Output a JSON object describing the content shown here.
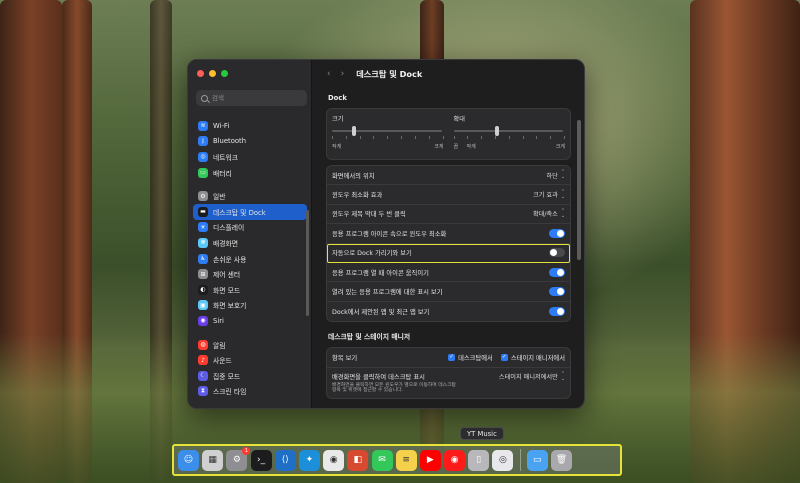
{
  "window": {
    "title": "데스크탑 및 Dock",
    "back_icon": "chevron-left-icon",
    "forward_icon": "chevron-right-icon"
  },
  "sidebar": {
    "search_placeholder": "검색",
    "items": [
      {
        "label": "Wi-Fi",
        "icon": "wifi-icon",
        "color": "#2d7cf6",
        "glyph": "≋"
      },
      {
        "label": "Bluetooth",
        "icon": "bluetooth-icon",
        "color": "#2d7cf6",
        "glyph": "ᛒ"
      },
      {
        "label": "네트워크",
        "icon": "network-icon",
        "color": "#2d7cf6",
        "glyph": "◎"
      },
      {
        "label": "배터리",
        "icon": "battery-icon",
        "color": "#34c759",
        "glyph": "▭"
      },
      {
        "label": "일반",
        "icon": "gear-icon",
        "color": "#8e8e93",
        "glyph": "⚙"
      },
      {
        "label": "데스크탑 및 Dock",
        "icon": "dock-icon",
        "color": "#1c1c1e",
        "glyph": "▬"
      },
      {
        "label": "디스플레이",
        "icon": "display-icon",
        "color": "#2d7cf6",
        "glyph": "☀"
      },
      {
        "label": "배경화면",
        "icon": "wallpaper-icon",
        "color": "#5ac8fa",
        "glyph": "❋"
      },
      {
        "label": "손쉬운 사용",
        "icon": "accessibility-icon",
        "color": "#2d7cf6",
        "glyph": "♿"
      },
      {
        "label": "제어 센터",
        "icon": "control-center-icon",
        "color": "#8e8e93",
        "glyph": "⊞"
      },
      {
        "label": "화면 모드",
        "icon": "appearance-icon",
        "color": "#1c1c1e",
        "glyph": "◐"
      },
      {
        "label": "화면 보호기",
        "icon": "screensaver-icon",
        "color": "#5ac8fa",
        "glyph": "▣"
      },
      {
        "label": "Siri",
        "icon": "siri-icon",
        "color": "#6a3de8",
        "glyph": "◉"
      },
      {
        "label": "알림",
        "icon": "notifications-icon",
        "color": "#ff3b30",
        "glyph": "◍"
      },
      {
        "label": "사운드",
        "icon": "sound-icon",
        "color": "#ff3b30",
        "glyph": "♪"
      },
      {
        "label": "집중 모드",
        "icon": "focus-icon",
        "color": "#5e5ce6",
        "glyph": "☾"
      },
      {
        "label": "스크린 타임",
        "icon": "screentime-icon",
        "color": "#5e5ce6",
        "glyph": "⧗"
      }
    ],
    "active_index": 5
  },
  "dock_section": {
    "header": "Dock",
    "size": {
      "label": "크기",
      "min": "작게",
      "max": "크게",
      "value": 0.18
    },
    "magnify": {
      "label": "확대",
      "min": "끔",
      "small": "작게",
      "max": "크게",
      "value": 0.38
    }
  },
  "rows": [
    {
      "label": "화면에서의 위치",
      "type": "popup",
      "value": "하단"
    },
    {
      "label": "윈도우 최소화 효과",
      "type": "popup",
      "value": "크기 효과"
    },
    {
      "label": "윈도우 제목 막대 두 번 클릭",
      "type": "popup",
      "value": "확대/축소"
    },
    {
      "label": "응용 프로그램 아이콘 속으로 윈도우 최소화",
      "type": "toggle",
      "value": true
    },
    {
      "label": "자동으로 Dock 가리기와 보기",
      "type": "toggle",
      "value": false
    },
    {
      "label": "응용 프로그램 열 때 아이콘 움직이기",
      "type": "toggle",
      "value": true
    },
    {
      "label": "열려 있는 응용 프로그램에 대한 표시 보기",
      "type": "toggle",
      "value": true
    },
    {
      "label": "Dock에서 제안된 앱 및 최근 앱 보기",
      "type": "toggle",
      "value": true
    }
  ],
  "stage_section": {
    "header": "데스크탑 및 스테이지 매니저",
    "show_items": {
      "label": "항목 보기",
      "opt1": "데스크탑에서",
      "opt2": "스테이지 매니저에서"
    },
    "click_wallpaper": {
      "label": "배경화면을 클릭하여 데스크탑 표시",
      "value": "스테이지 매니저에서만",
      "desc1": "배경화면을 클릭하면 모든 윈도우가 옆으로 이동하여 데스크탑",
      "desc2": "항목 및 위젯에 접근할 수 있습니다."
    }
  },
  "tooltip": "YT Music",
  "dock_apps": [
    {
      "name": "finder-icon",
      "color": "#3b8eea",
      "glyph": "☺"
    },
    {
      "name": "launchpad-icon",
      "color": "#d0d0d0",
      "glyph": "▦"
    },
    {
      "name": "system-settings-icon",
      "color": "#8e8e93",
      "glyph": "⚙",
      "badge": "1"
    },
    {
      "name": "terminal-icon",
      "color": "#1c1c1e",
      "glyph": "›_"
    },
    {
      "name": "vscode-icon",
      "color": "#1f6fc7",
      "glyph": "⟨⟩"
    },
    {
      "name": "bird-app-icon",
      "color": "#1c8fd8",
      "glyph": "✦"
    },
    {
      "name": "chrome-icon",
      "color": "#e9e9e9",
      "glyph": "◉"
    },
    {
      "name": "office-icon",
      "color": "#d84a2f",
      "glyph": "◧"
    },
    {
      "name": "messages-icon",
      "color": "#34c759",
      "glyph": "✉"
    },
    {
      "name": "notes-icon",
      "color": "#f5d04a",
      "glyph": "≡"
    },
    {
      "name": "youtube-icon",
      "color": "#ff0000",
      "glyph": "▶"
    },
    {
      "name": "yt-music-icon",
      "color": "#ff1a1a",
      "glyph": "◉"
    },
    {
      "name": "phone-mirror-icon",
      "color": "#b7b7bc",
      "glyph": "▯"
    },
    {
      "name": "screenshot-icon",
      "color": "#e8e8ec",
      "glyph": "◎"
    }
  ],
  "dock_stack": [
    {
      "name": "downloads-folder-icon",
      "color": "#4aa3f0",
      "glyph": "▭"
    },
    {
      "name": "trash-icon",
      "color": "#a8a8ad",
      "glyph": "🗑"
    }
  ]
}
